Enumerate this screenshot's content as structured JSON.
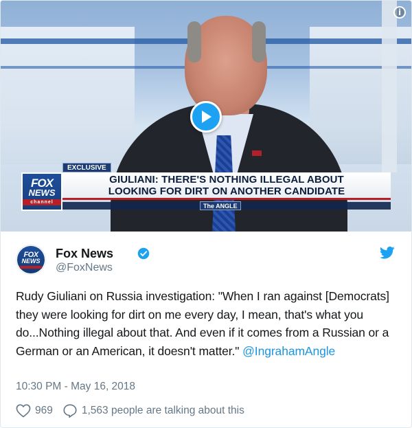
{
  "media": {
    "lower_third": {
      "tag": "EXCLUSIVE",
      "headline_line1": "GIULIANI: THERE'S NOTHING ILLEGAL ABOUT",
      "headline_line2": "LOOKING FOR DIRT ON ANOTHER CANDIDATE",
      "show": "The ANGLE",
      "logo_fox": "FOX",
      "logo_news": "NEWS",
      "logo_channel": "channel"
    },
    "play_icon": "play-icon",
    "info_icon_glyph": "i"
  },
  "tweet": {
    "author_name": "Fox News",
    "author_handle": "@FoxNews",
    "text": "Rudy Giuliani on Russia investigation: \"When I ran against [Democrats] they were looking for dirt on me every day, I mean, that's what you do...Nothing illegal about that. And even if it comes from a Russian or a German or an American, it doesn't matter.\"",
    "mention": "@IngrahamAngle",
    "timestamp": "10:30 PM - May 16, 2018",
    "like_count": "969",
    "talking_label": "1,563 people are talking about this"
  },
  "colors": {
    "accent": "#1da1f2",
    "link": "#1b95e0",
    "muted": "#657786",
    "fox_blue": "#1e4f9c",
    "fox_red": "#b71f26"
  }
}
